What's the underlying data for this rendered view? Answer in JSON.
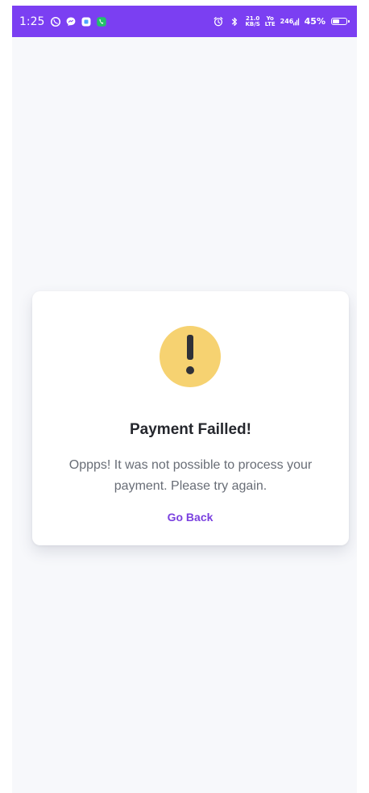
{
  "status_bar": {
    "time": "1:25",
    "battery_percent": "45%",
    "network_speed_top": "21.0",
    "network_speed_bottom": "KB/S",
    "volte_top": "Yo",
    "volte_bottom": "LTE",
    "signal_label": "246",
    "icons": [
      "whatsapp-icon",
      "messenger-icon",
      "app-icon",
      "phone-call-icon",
      "alarm-icon",
      "bluetooth-icon",
      "signal-icon",
      "battery-icon"
    ],
    "background_color": "#7b3ff2"
  },
  "dialog": {
    "title": "Payment Failled!",
    "message": "Oppps! It was not possible to process your payment. Please try again.",
    "action_label": "Go Back",
    "icon": "exclamation-icon",
    "icon_color": "#f6d271",
    "action_color": "#7a40df"
  }
}
